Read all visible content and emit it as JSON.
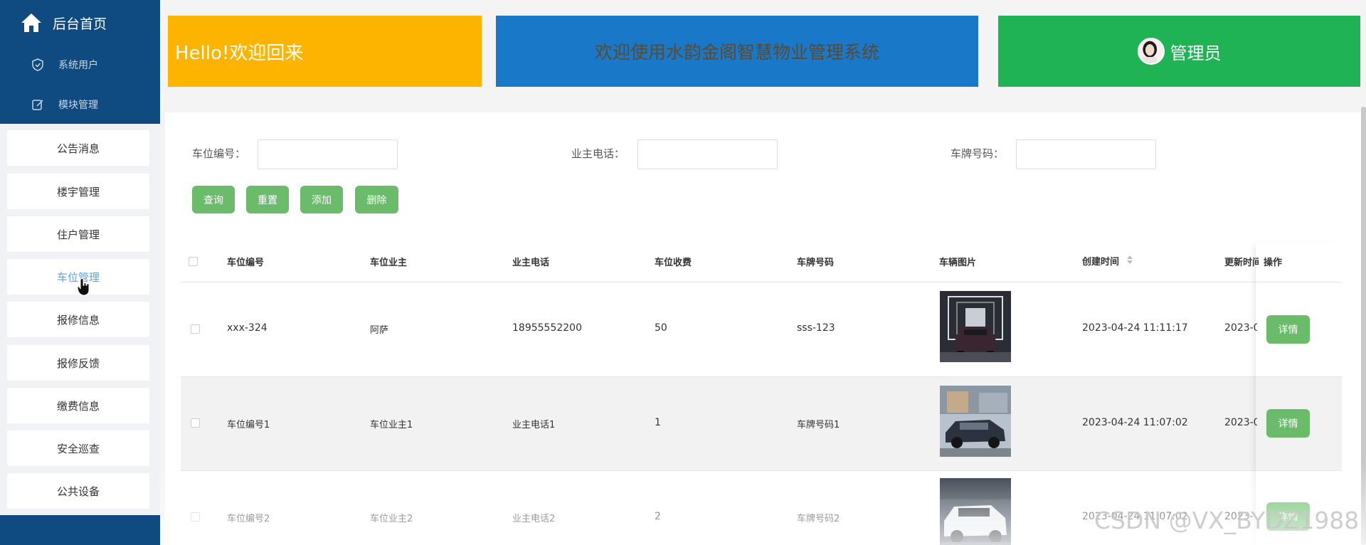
{
  "sidebar": {
    "home_label": "后台首页",
    "sub_items": [
      "系统用户",
      "模块管理"
    ],
    "items": [
      "公告消息",
      "楼宇管理",
      "住户管理",
      "车位管理",
      "报修信息",
      "报修反馈",
      "缴费信息",
      "安全巡查",
      "公共设备"
    ],
    "active_index": 3
  },
  "banners": {
    "greeting": "Hello!欢迎回来",
    "welcome": "欢迎使用水韵金阁智慧物业管理系统",
    "user": "管理员"
  },
  "filters": {
    "spot_no_label": "车位编号：",
    "owner_phone_label": "业主电话：",
    "plate_label": "车牌号码："
  },
  "buttons": {
    "query": "查询",
    "reset": "重置",
    "add": "添加",
    "delete": "删除"
  },
  "table": {
    "headers": [
      "车位编号",
      "车位业主",
      "业主电话",
      "车位收费",
      "车牌号码",
      "车辆图片",
      "创建时间",
      "更新时间",
      "操作"
    ],
    "rows": [
      {
        "spot_no": "xxx-324",
        "owner": "阿萨",
        "phone": "18955552200",
        "fee": "50",
        "plate": "sss-123",
        "created": "2023-04-24 11:11:17",
        "updated": "2023-0",
        "action": "详情"
      },
      {
        "spot_no": "车位编号1",
        "owner": "车位业主1",
        "phone": "业主电话1",
        "fee": "1",
        "plate": "车牌号码1",
        "created": "2023-04-24 11:07:02",
        "updated": "2023-0",
        "action": "详情"
      },
      {
        "spot_no": "车位编号2",
        "owner": "车位业主2",
        "phone": "业主电话2",
        "fee": "2",
        "plate": "车牌号码2",
        "created": "2023-04-24 11:07:02",
        "updated": "2023-",
        "action": "详情"
      }
    ]
  },
  "watermark": "CSDN @VX_BYDZ1988",
  "colors": {
    "sidebar_dark": "#0f4a80",
    "banner_yellow": "#fdb400",
    "banner_blue": "#1a78c8",
    "banner_green": "#1fb356",
    "button_green": "#6abc6a",
    "active_link": "#5aa4e0"
  }
}
